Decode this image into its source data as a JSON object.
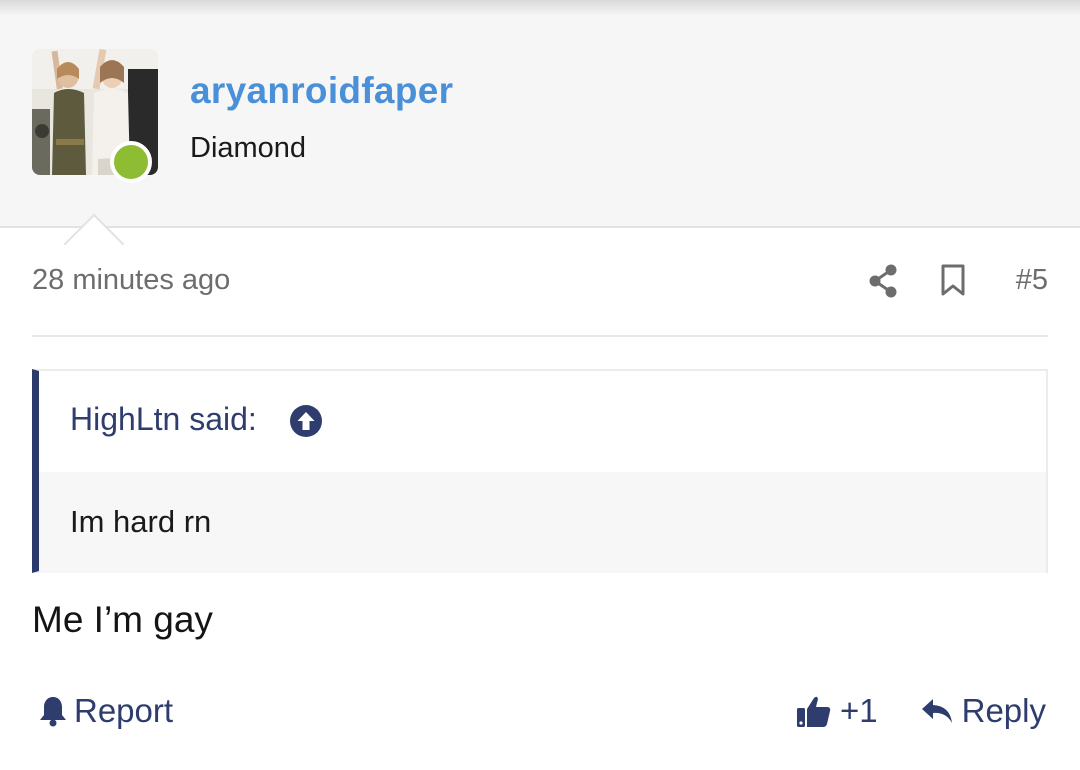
{
  "post": {
    "author": {
      "username": "aryanroidfaper",
      "title": "Diamond",
      "online": true,
      "online_color": "#8ebc32",
      "username_color": "#4a90d9"
    },
    "timestamp": "28 minutes ago",
    "post_number": "#5",
    "icons": [
      "share-icon",
      "bookmark-icon",
      "arrow-up-circle-icon",
      "bell-icon",
      "thumbs-up-icon",
      "reply-arrow-icon"
    ],
    "quote": {
      "attribution": "HighLtn said:",
      "text": "Im hard rn",
      "accent_color": "#2b3a6b"
    },
    "message": "Me I’m gay",
    "actions": {
      "report_label": "Report",
      "like_label": "+1",
      "reply_label": "Reply"
    }
  }
}
